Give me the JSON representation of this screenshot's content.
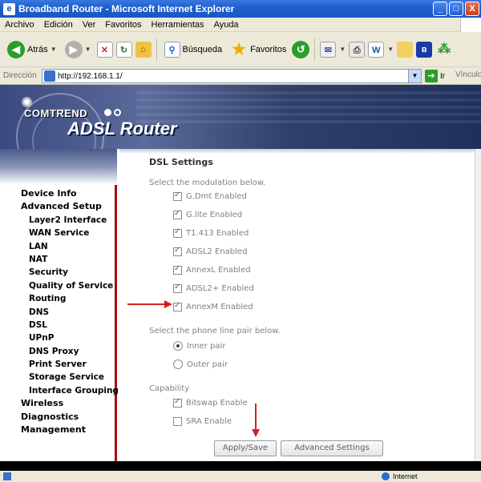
{
  "window": {
    "title": "Broadband Router - Microsoft Internet Explorer",
    "controls": [
      "_",
      "□",
      "X"
    ]
  },
  "menu": [
    "Archivo",
    "Edición",
    "Ver",
    "Favoritos",
    "Herramientas",
    "Ayuda"
  ],
  "toolbar": {
    "back_label": "Atrás",
    "search_label": "Búsqueda",
    "favorites_label": "Favoritos"
  },
  "address": {
    "label": "Dirección",
    "url": "http://192.168.1.1/",
    "go_label": "Ir",
    "links_label": "Vínculos"
  },
  "banner": {
    "brand": "COMTREND",
    "product": "ADSL Router"
  },
  "nav": {
    "items": [
      {
        "label": "Device Info",
        "level": "top"
      },
      {
        "label": "Advanced Setup",
        "level": "top"
      },
      {
        "label": "Layer2 Interface",
        "level": "sub"
      },
      {
        "label": "WAN Service",
        "level": "sub"
      },
      {
        "label": "LAN",
        "level": "sub"
      },
      {
        "label": "NAT",
        "level": "sub"
      },
      {
        "label": "Security",
        "level": "sub"
      },
      {
        "label": "Quality of Service",
        "level": "sub"
      },
      {
        "label": "Routing",
        "level": "sub"
      },
      {
        "label": "DNS",
        "level": "sub"
      },
      {
        "label": "DSL",
        "level": "sub"
      },
      {
        "label": "UPnP",
        "level": "sub"
      },
      {
        "label": "DNS Proxy",
        "level": "sub"
      },
      {
        "label": "Print Server",
        "level": "sub"
      },
      {
        "label": "Storage Service",
        "level": "sub"
      },
      {
        "label": "Interface Grouping",
        "level": "sub"
      },
      {
        "label": "Wireless",
        "level": "top"
      },
      {
        "label": "Diagnostics",
        "level": "top"
      },
      {
        "label": "Management",
        "level": "top"
      }
    ]
  },
  "dsl": {
    "heading": "DSL Settings",
    "modulation_label": "Select the modulation below.",
    "modulations": [
      {
        "label": "G.Dmt Enabled",
        "checked": true
      },
      {
        "label": "G.lite Enabled",
        "checked": true
      },
      {
        "label": "T1.413 Enabled",
        "checked": true
      },
      {
        "label": "ADSL2 Enabled",
        "checked": true
      },
      {
        "label": "AnnexL Enabled",
        "checked": true
      },
      {
        "label": "ADSL2+ Enabled",
        "checked": true
      },
      {
        "label": "AnnexM Enabled",
        "checked": true
      }
    ],
    "phone_label": "Select the phone line pair below.",
    "phone_options": [
      {
        "label": "Inner pair",
        "selected": true
      },
      {
        "label": "Outer pair",
        "selected": false
      }
    ],
    "capability_label": "Capability",
    "capabilities": [
      {
        "label": "Bitswap Enable",
        "checked": true
      },
      {
        "label": "SRA Enable",
        "checked": false
      }
    ],
    "apply_button": "Apply/Save",
    "advanced_button": "Advanced Settings"
  },
  "status": {
    "zone": "Internet"
  },
  "colors": {
    "annotation_arrow": "#d42020",
    "nav_border": "#a01010"
  }
}
